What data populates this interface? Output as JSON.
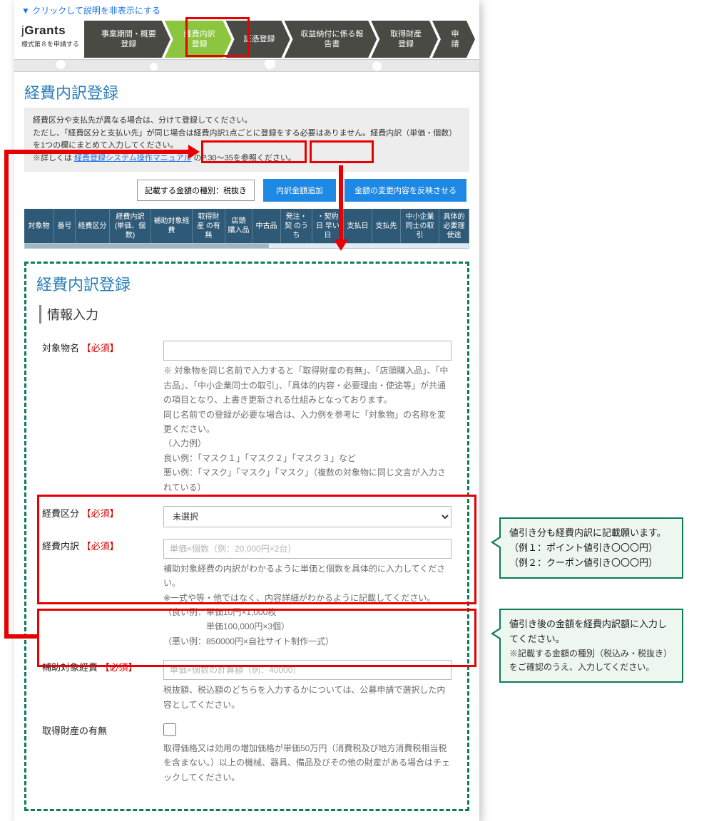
{
  "hide_link": "クリックして説明を非表示にする",
  "brand": {
    "logo_j": "j",
    "logo_rest": "Grants",
    "sub": "様式第８を申請する"
  },
  "nav": {
    "items": [
      "事業期間・概要登録",
      "経費内訳登録",
      "証憑登録",
      "収益納付に係る報告書",
      "取得財産登録",
      "申請"
    ]
  },
  "section_title": "経費内訳登録",
  "notice": {
    "l1": "経費区分や支払先が異なる場合は、分けて登録してください。",
    "l2": "ただし、「経費区分と支払い先」が同じ場合は経費内訳1点ごとに登録をする必要はありません。経費内訳（単価・個数）を1つの欄にまとめて入力してください。",
    "l3_a": "※詳しくは ",
    "l3_link": "経費登録システム操作マニュアル",
    "l3_b": " のP.30～35を参照ください。"
  },
  "amount_type": "記載する金額の種別：税抜き",
  "btn_add": "内訳金額追加",
  "btn_reflect": "金額の変更内容を反映させる",
  "thead": [
    "対象物",
    "番号",
    "経費区分",
    "経費内訳\n(単価、個数)",
    "補助対象経費",
    "取得財産\nの有無",
    "店頭\n購入品",
    "中古品",
    "発注・契\nのうち",
    "・契約日\n早い日",
    "支払日",
    "支払先",
    "中小企業\n同士の取引",
    "具体的\n必要理\n使途"
  ],
  "form": {
    "heading": "経費内訳登録",
    "sub": "情報入力",
    "f1": {
      "label": "対象物名",
      "req": "【必須】",
      "hint": "※ 対象物を同じ名前で入力すると「取得財産の有無」、「店頭購入品」、「中古品」、「中小企業同士の取引」、「具体的内容・必要理由・使途等」が共通の項目となり、上書き更新される仕組みとなっております。\n同じ名前での登録が必要な場合は、入力例を参考に「対象物」の名称を変更ください。\n（入力例）\n良い例：「マスク１」「マスク２」「マスク３」など\n悪い例：「マスク」「マスク」「マスク」（複数の対象物に同じ文言が入力されている）"
    },
    "f2": {
      "label": "経費区分",
      "req": "【必須】",
      "value": "未選択"
    },
    "f3": {
      "label": "経費内訳",
      "req": "【必須】",
      "ph": "単価×個数（例：20,000円×2台）",
      "hint": "補助対象経費の内訳がわかるように単価と個数を具体的に入力してください。\n※一式や等・他ではなく、内容詳細がわかるように記載してください。\n（良い例：単価10円×1,000枚\n　　　　　単価100,000円×3個）\n（悪い例：850000円×自社サイト制作一式）"
    },
    "f4": {
      "label": "補助対象経費",
      "req": "【必須】",
      "ph": "単価×個数の計算額（例：40000）",
      "hint": "税抜額、税込額のどちらを入力するかについては、公募申請で選択した内容としてください。"
    },
    "f5": {
      "label": "取得財産の有無",
      "hint": "取得価格又は効用の増加価格が単価50万円（消費税及び地方消費税相当税を含まない。）以上の機械、器具、備品及びその他の財産がある場合はチェックしてください。"
    }
  },
  "callout1": {
    "l1": "値引き分も経費内訳に記載願います。",
    "l2": "（例１：ポイント値引き〇〇〇円）",
    "l3": "（例２：クーポン値引き〇〇〇円）"
  },
  "callout2": {
    "l1": "値引き後の金額を経費内訳額に入力してください。",
    "l2": "※記載する金額の種別（税込み・税抜き）をご確認のうえ、入力してください。"
  }
}
